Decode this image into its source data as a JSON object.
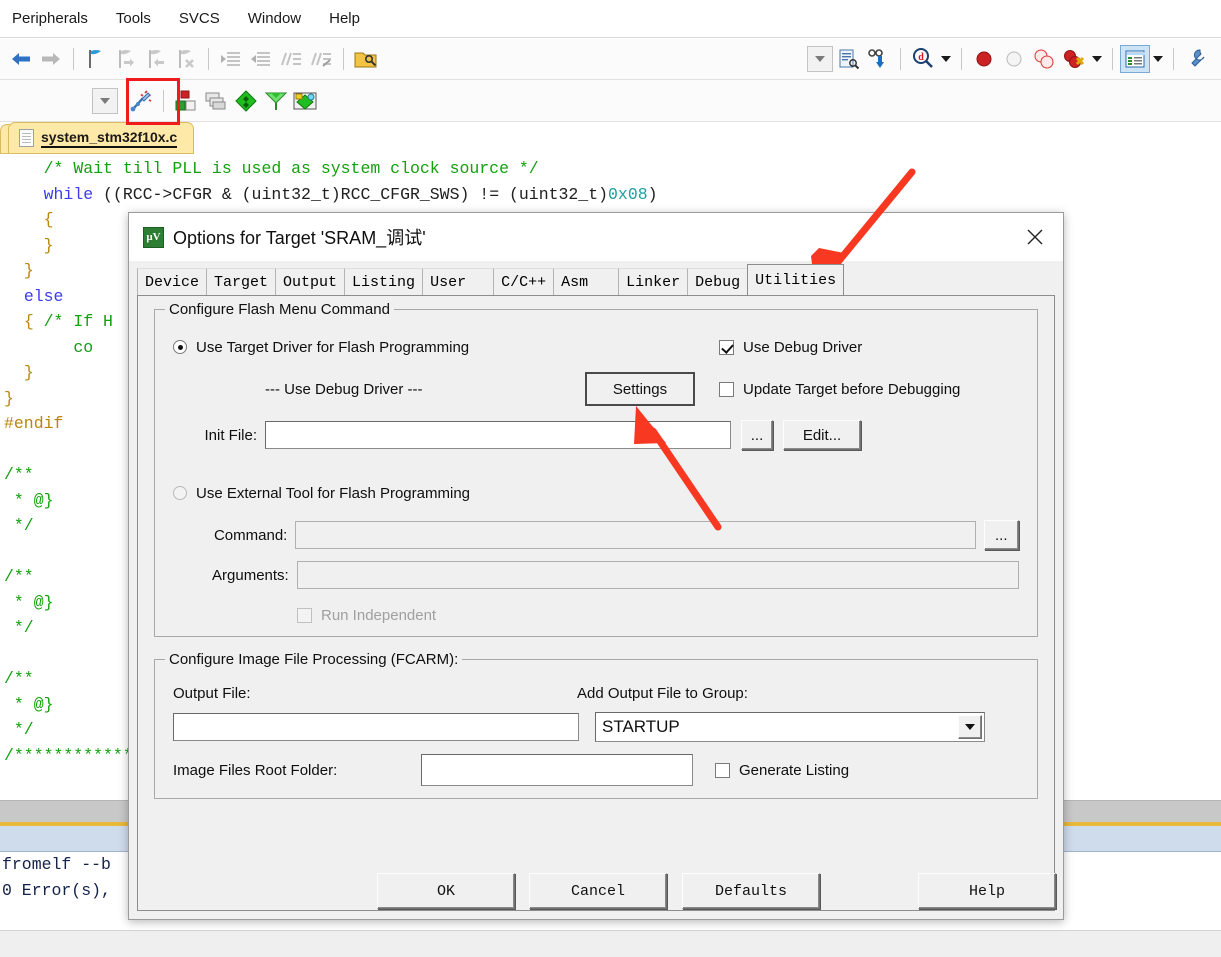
{
  "app": {
    "menus": [
      "Peripherals",
      "Tools",
      "SVCS",
      "Window",
      "Help"
    ],
    "toolbar_row1_icons": [
      "back-arrow-icon",
      "forward-arrow-icon",
      "bookmark-icon",
      "bookmark-next-icon",
      "bookmark-prev-icon",
      "bookmark-clear-icon",
      "indent-icon",
      "outdent-icon",
      "comment-icon",
      "uncomment-icon",
      "open-folder-icon"
    ],
    "toolbar_row1_right_icons": [
      "dropdown-icon",
      "target-options-icon",
      "download-icon",
      "debug-magnifier-icon",
      "breakpoint-icon",
      "breakpoint-disabled-icon",
      "breakpoints-icon",
      "kill-breakpoints-icon",
      "project-window-icon",
      "configure-icon"
    ],
    "toolbar_row2_icons": [
      "dropdown-icon",
      "build-wizard-icon",
      "build-target-icon",
      "batch-build-icon",
      "translate-icon",
      "build-icon",
      "rebuild-icon"
    ],
    "editor_tab": {
      "label": "system_stm32f10x.c",
      "icon": "c-file-icon"
    }
  },
  "editor": {
    "lines": [
      {
        "indent": 4,
        "parts": [
          {
            "t": "/* Wait till PLL is used as system clock source */",
            "c": "c-com"
          }
        ]
      },
      {
        "indent": 4,
        "parts": [
          {
            "t": "while",
            "c": "c-kw"
          },
          {
            "t": " ((RCC->CFGR & (uint32_t)RCC_CFGR_SWS) != (uint32_t)",
            "c": "c-pl"
          },
          {
            "t": "0x08",
            "c": "c-num"
          },
          {
            "t": ")",
            "c": "c-pl"
          }
        ]
      },
      {
        "indent": 4,
        "parts": [
          {
            "t": "{",
            "c": "c-pp"
          }
        ]
      },
      {
        "indent": 4,
        "parts": [
          {
            "t": "}",
            "c": "c-pp"
          }
        ]
      },
      {
        "indent": 2,
        "parts": [
          {
            "t": "}",
            "c": "c-pp"
          }
        ]
      },
      {
        "indent": 2,
        "parts": [
          {
            "t": "else",
            "c": "c-kw"
          }
        ]
      },
      {
        "indent": 2,
        "parts": [
          {
            "t": "{ ",
            "c": "c-pp"
          },
          {
            "t": "/* If H",
            "c": "c-com"
          }
        ]
      },
      {
        "indent": 7,
        "parts": [
          {
            "t": "co",
            "c": "c-com"
          }
        ]
      },
      {
        "indent": 2,
        "parts": [
          {
            "t": "}",
            "c": "c-pp"
          }
        ]
      },
      {
        "indent": 0,
        "parts": [
          {
            "t": "}",
            "c": "c-pp"
          }
        ]
      },
      {
        "indent": 0,
        "parts": [
          {
            "t": "#endif",
            "c": "c-pp"
          }
        ]
      },
      {
        "indent": 0,
        "parts": [
          {
            "t": "",
            "c": "c-pl"
          }
        ]
      },
      {
        "indent": 0,
        "parts": [
          {
            "t": "/**",
            "c": "c-com"
          }
        ]
      },
      {
        "indent": 1,
        "parts": [
          {
            "t": "* @}",
            "c": "c-com"
          }
        ]
      },
      {
        "indent": 1,
        "parts": [
          {
            "t": "*/",
            "c": "c-com"
          }
        ]
      },
      {
        "indent": 0,
        "parts": [
          {
            "t": "",
            "c": "c-pl"
          }
        ]
      },
      {
        "indent": 0,
        "parts": [
          {
            "t": "/**",
            "c": "c-com"
          }
        ]
      },
      {
        "indent": 1,
        "parts": [
          {
            "t": "* @}",
            "c": "c-com"
          }
        ]
      },
      {
        "indent": 1,
        "parts": [
          {
            "t": "*/",
            "c": "c-com"
          }
        ]
      },
      {
        "indent": 0,
        "parts": [
          {
            "t": "",
            "c": "c-pl"
          }
        ]
      },
      {
        "indent": 0,
        "parts": [
          {
            "t": "/**",
            "c": "c-com"
          }
        ]
      },
      {
        "indent": 1,
        "parts": [
          {
            "t": "* @}",
            "c": "c-com"
          }
        ]
      },
      {
        "indent": 1,
        "parts": [
          {
            "t": "*/",
            "c": "c-com"
          }
        ]
      },
      {
        "indent": 0,
        "parts": [
          {
            "t": "/************",
            "c": "c-com"
          }
        ]
      }
    ]
  },
  "build_output": {
    "line1": "fromelf --b",
    "line2": "0 Error(s),"
  },
  "dialog": {
    "title": "Options for Target 'SRAM_调试'",
    "icon": "keil-target-icon",
    "close_icon": "close-icon",
    "tabs": [
      {
        "label": "Device",
        "active": false
      },
      {
        "label": "Target",
        "active": false
      },
      {
        "label": "Output",
        "active": false
      },
      {
        "label": "Listing",
        "active": false
      },
      {
        "label": "User",
        "active": false
      },
      {
        "label": "C/C++",
        "active": false
      },
      {
        "label": "Asm",
        "active": false
      },
      {
        "label": "Linker",
        "active": false
      },
      {
        "label": "Debug",
        "active": false
      },
      {
        "label": "Utilities",
        "active": true
      }
    ],
    "flash_group": {
      "legend": "Configure Flash Menu Command",
      "radio_target_driver": {
        "label": "Use Target Driver for Flash Programming",
        "checked": true
      },
      "driver_name": "--- Use Debug Driver ---",
      "settings_button": "Settings",
      "use_debug_driver": {
        "label": "Use Debug Driver",
        "checked": true
      },
      "update_target": {
        "label": "Update Target before Debugging",
        "checked": false
      },
      "init_file_label": "Init File:",
      "init_file_value": "",
      "browse_button": "...",
      "edit_button": "Edit...",
      "radio_external_tool": {
        "label": "Use External Tool for Flash Programming",
        "checked": false
      },
      "command_label": "Command:",
      "command_value": "",
      "command_browse": "...",
      "arguments_label": "Arguments:",
      "arguments_value": "",
      "run_independent": {
        "label": "Run Independent",
        "checked": false,
        "disabled": true
      }
    },
    "fcarm_group": {
      "legend": "Configure Image File Processing (FCARM):",
      "output_file_label": "Output File:",
      "output_file_value": "",
      "add_group_label": "Add Output File  to Group:",
      "add_group_value": "STARTUP",
      "add_group_options": [
        "STARTUP"
      ],
      "root_folder_label": "Image Files Root Folder:",
      "root_folder_value": "",
      "generate_listing": {
        "label": "Generate Listing",
        "checked": false
      }
    },
    "buttons": {
      "ok": "OK",
      "cancel": "Cancel",
      "defaults": "Defaults",
      "help": "Help"
    }
  },
  "annotations": {
    "highlight_color": "#ef1c1c",
    "arrow_color": "#f93822",
    "arrow_to_utilities_tab": "arrow-annotation",
    "arrow_to_settings_button": "arrow-annotation",
    "red_box_on_toolbar": "highlight-box-annotation"
  }
}
